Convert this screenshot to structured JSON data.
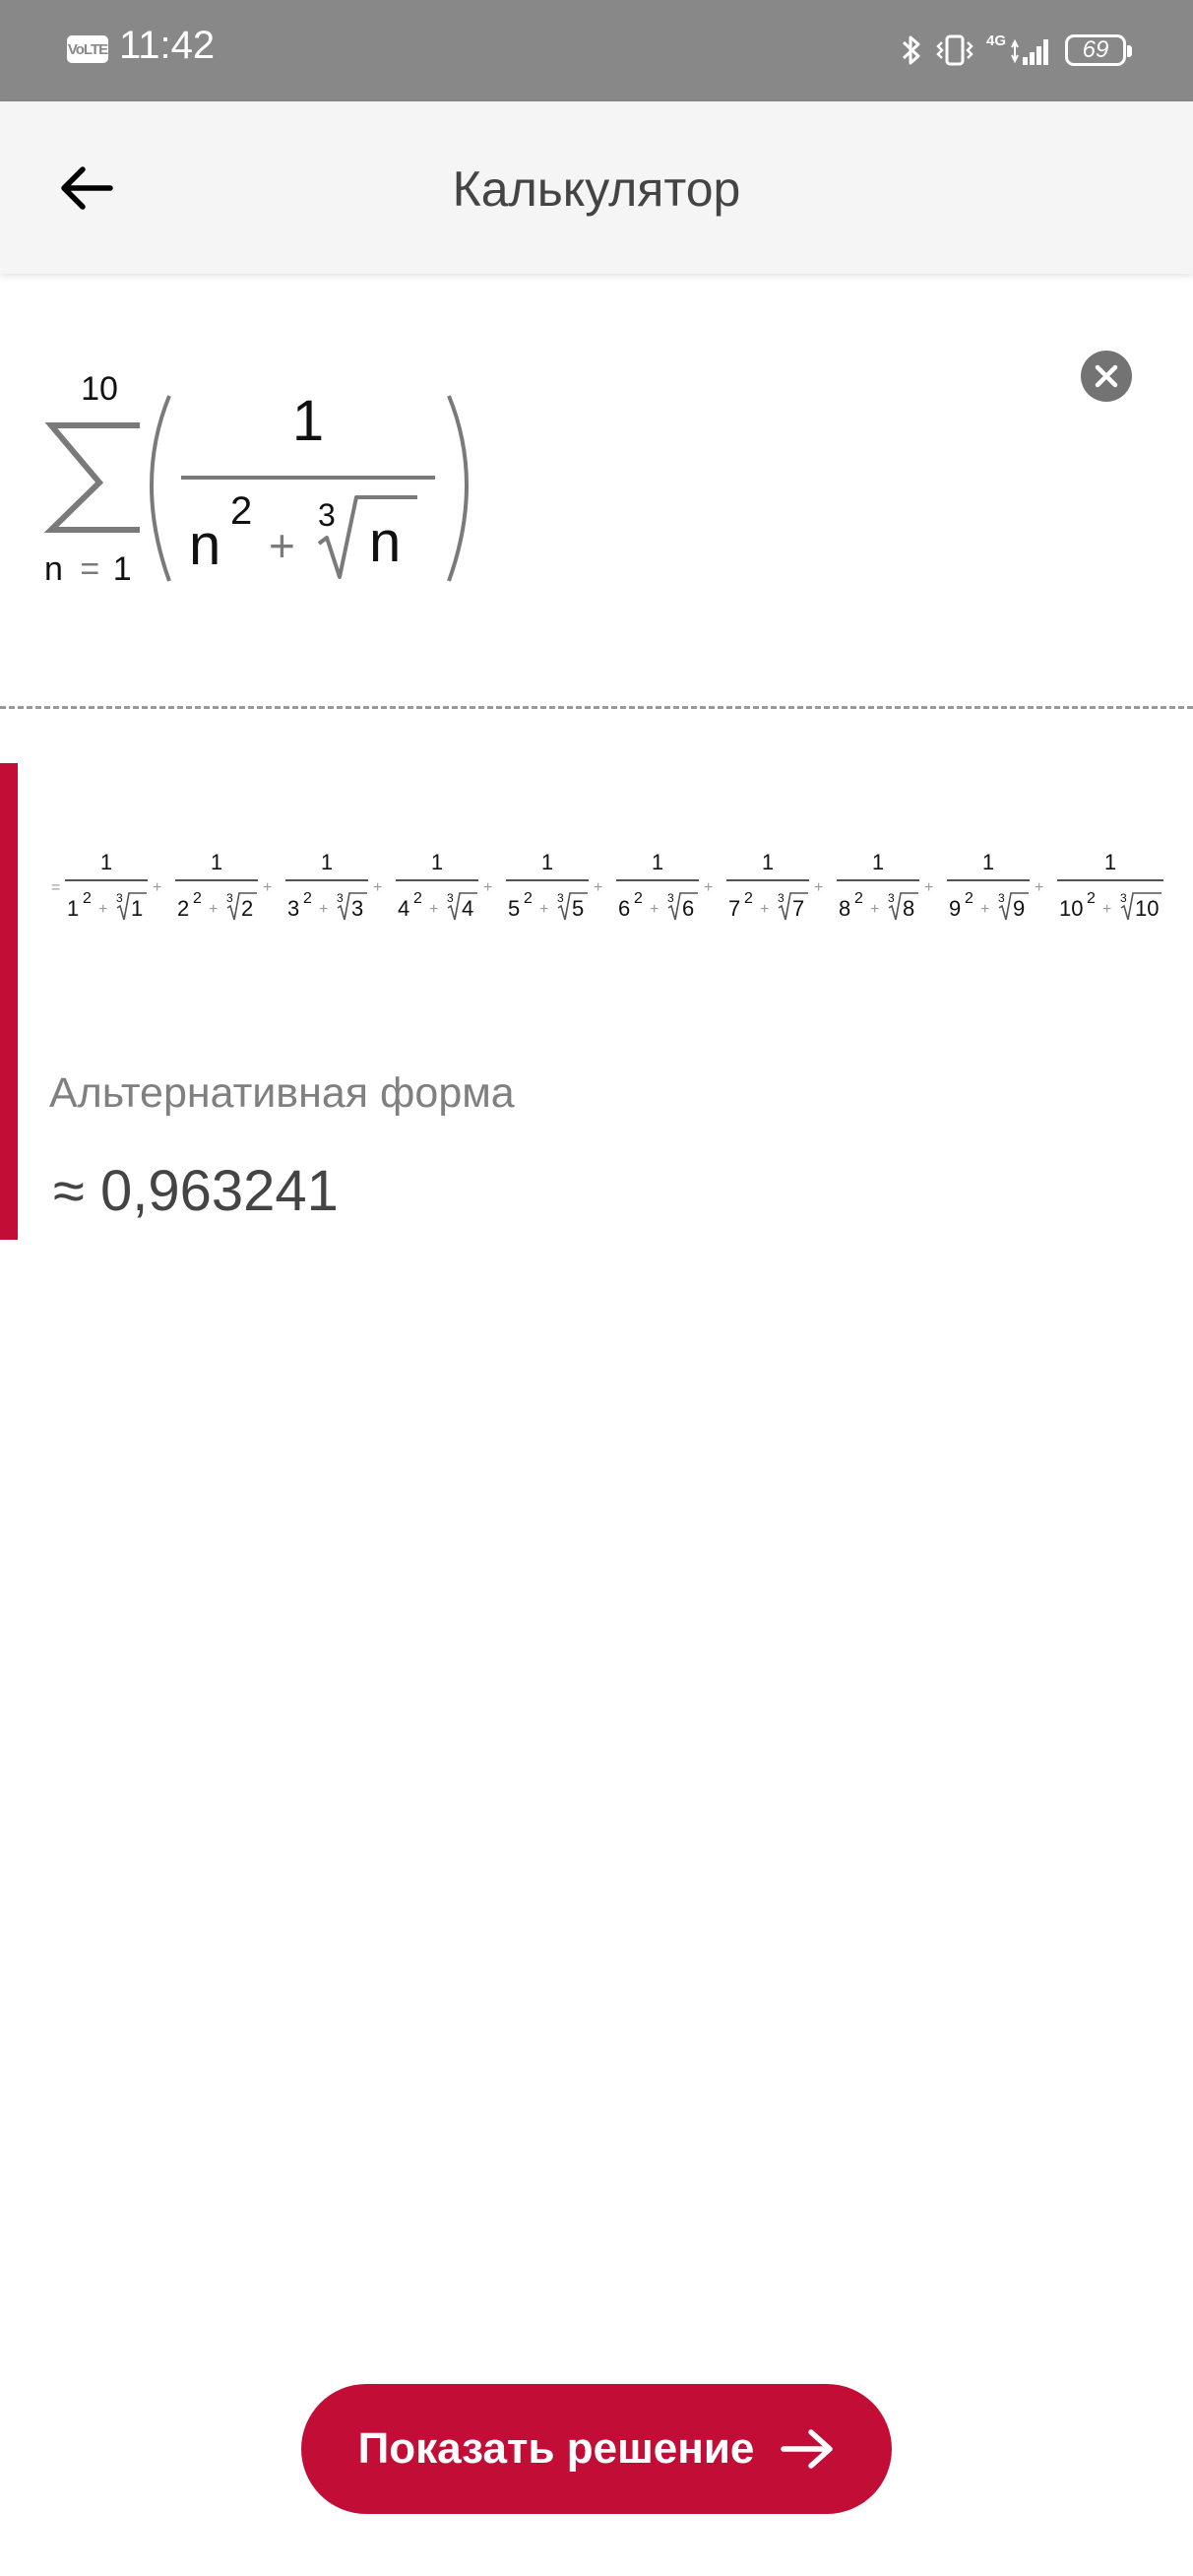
{
  "status_bar": {
    "volte": "VoLTE",
    "time": "11:42",
    "network": "4G",
    "battery": "69",
    "icons": [
      "bluetooth-icon",
      "vibrate-icon",
      "signal-icon",
      "battery-icon"
    ]
  },
  "app_bar": {
    "title": "Калькулятор",
    "back_icon": "arrow-left-icon"
  },
  "formula": {
    "upper_limit": "10",
    "lower_limit": "n = 1",
    "lower_var": "n",
    "lower_eq": "=",
    "lower_val": "1",
    "numerator": "1",
    "denominator_base": "n",
    "denominator_exponent": "2",
    "plus": "+",
    "root_index": "3",
    "radicand": "n",
    "clear_icon": "close-circle-icon"
  },
  "result": {
    "equals": "=",
    "terms": [
      {
        "num": "1",
        "base": "1",
        "exp": "2",
        "root_index": "3",
        "radicand": "1"
      },
      {
        "num": "1",
        "base": "2",
        "exp": "2",
        "root_index": "3",
        "radicand": "2"
      },
      {
        "num": "1",
        "base": "3",
        "exp": "2",
        "root_index": "3",
        "radicand": "3"
      },
      {
        "num": "1",
        "base": "4",
        "exp": "2",
        "root_index": "3",
        "radicand": "4"
      },
      {
        "num": "1",
        "base": "5",
        "exp": "2",
        "root_index": "3",
        "radicand": "5"
      },
      {
        "num": "1",
        "base": "6",
        "exp": "2",
        "root_index": "3",
        "radicand": "6"
      },
      {
        "num": "1",
        "base": "7",
        "exp": "2",
        "root_index": "3",
        "radicand": "7"
      },
      {
        "num": "1",
        "base": "8",
        "exp": "2",
        "root_index": "3",
        "radicand": "8"
      },
      {
        "num": "1",
        "base": "9",
        "exp": "2",
        "root_index": "3",
        "radicand": "9"
      },
      {
        "num": "1",
        "base": "10",
        "exp": "2",
        "root_index": "3",
        "radicand": "10"
      }
    ],
    "plus": "+",
    "alternative_form_label": "Альтернативная форма",
    "approximate_value": "≈ 0,963241"
  },
  "solution_button": {
    "label": "Показать решение",
    "icon": "arrow-right-icon"
  },
  "colors": {
    "accent": "#c20e36",
    "status_bar": "#888888",
    "app_bar": "#f5f5f5"
  }
}
